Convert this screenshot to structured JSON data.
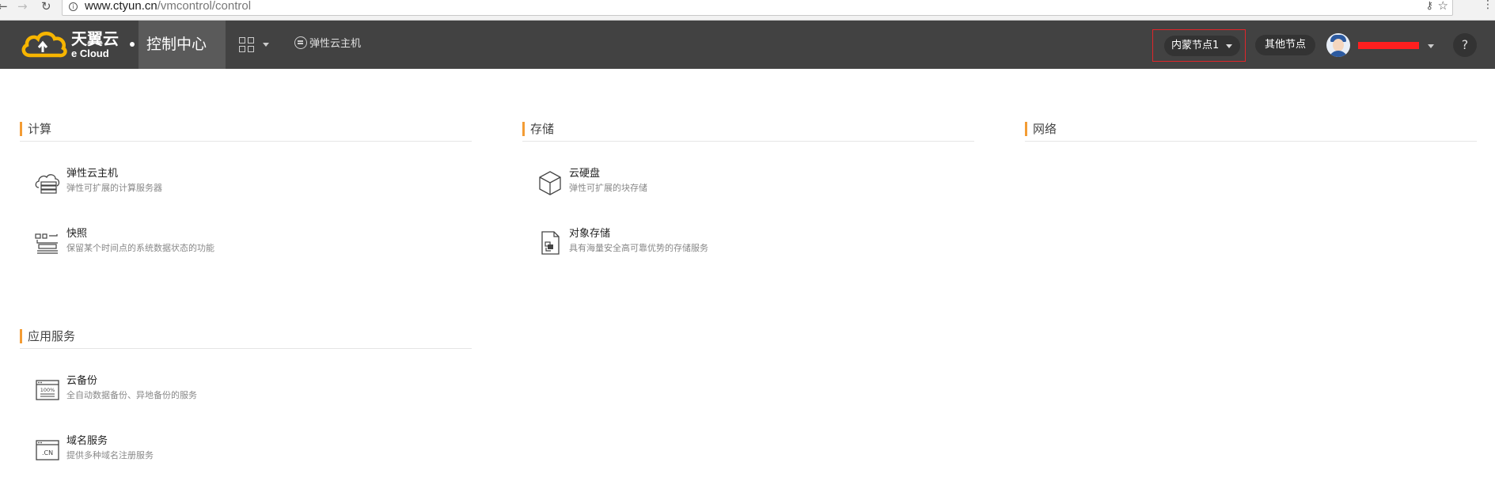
{
  "browser": {
    "url_host": "www.ctyun.cn",
    "url_path": "/vmcontrol/control"
  },
  "header": {
    "logo_title": "天翼云",
    "logo_sub": "e Cloud",
    "console_tab": "控制中心",
    "quick_link": "弹性云主机",
    "region_select": "内蒙节点1",
    "other_nodes": "其他节点",
    "help": "?"
  },
  "sections": {
    "compute": {
      "title": "计算",
      "items": [
        {
          "title": "弹性云主机",
          "desc": "弹性可扩展的计算服务器",
          "icon": "cloud-server-icon"
        },
        {
          "title": "快照",
          "desc": "保留某个时间点的系统数据状态的功能",
          "icon": "snapshot-icon"
        }
      ]
    },
    "storage": {
      "title": "存储",
      "items": [
        {
          "title": "云硬盘",
          "desc": "弹性可扩展的块存储",
          "icon": "cube-icon"
        },
        {
          "title": "对象存储",
          "desc": "具有海量安全高可靠优势的存储服务",
          "icon": "object-file-icon"
        }
      ]
    },
    "network": {
      "title": "网络"
    },
    "app_services": {
      "title": "应用服务",
      "items": [
        {
          "title": "云备份",
          "desc": "全自动数据备份、异地备份的服务",
          "icon": "backup-icon",
          "icon_text": "100%"
        },
        {
          "title": "域名服务",
          "desc": "提供多种域名注册服务",
          "icon": "domain-icon",
          "icon_text": ".CN"
        }
      ]
    }
  },
  "colors": {
    "header_bg": "#424242",
    "accent_orange": "#f39c34",
    "highlight_red": "#e0262a",
    "logo_yellow": "#f7b500"
  }
}
